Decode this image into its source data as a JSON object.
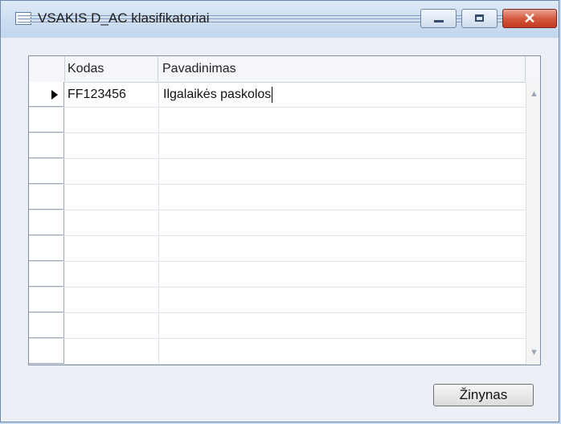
{
  "window": {
    "title": "VSAKIS D_AC klasifikatoriai",
    "icon": "table-window-icon",
    "controls": [
      "minimize-icon",
      "maximize-icon",
      "close-icon"
    ]
  },
  "grid": {
    "columns": [
      "Kodas",
      "Pavadinimas"
    ],
    "rows": [
      {
        "kodas": "FF123456",
        "pavadinimas": "Ilgalaikės paskolos",
        "current": true
      }
    ],
    "empty_rows": 10
  },
  "buttons": {
    "zinynas": "Žinynas"
  },
  "colors": {
    "close_button": "#d45a3f",
    "window_bg": "#ecf0f6"
  }
}
